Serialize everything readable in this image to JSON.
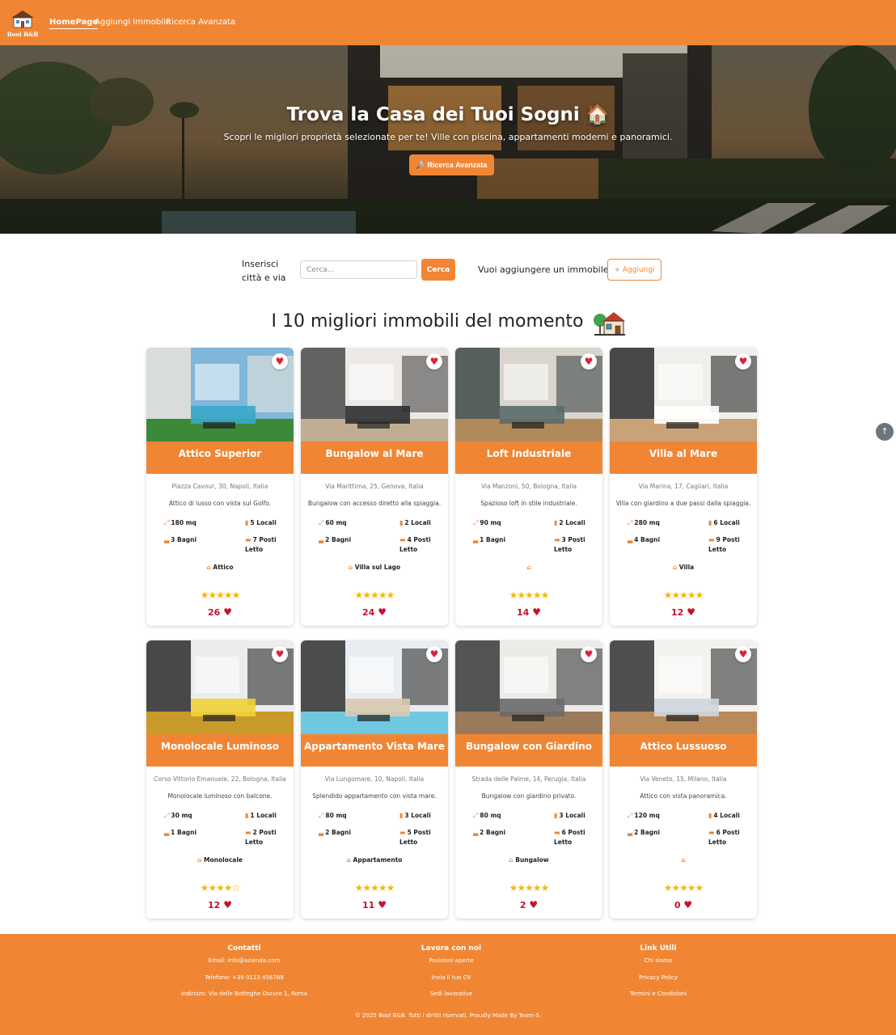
{
  "nav": {
    "logo_text": "Bool B&B",
    "links": [
      "HomePage",
      "Aggiungi Immobile",
      "Ricerca Avanzata"
    ]
  },
  "hero": {
    "title": "Trova la Casa dei Tuoi Sogni 🏠",
    "subtitle": "Scopri le migliori proprietà selezionate per te! Ville con piscina, appartamenti moderni e panoramici.",
    "button": "🔎 Ricerca Avanzata"
  },
  "search": {
    "label": "Inserisci città e via",
    "placeholder": "Cerca...",
    "button": "Cerca",
    "add_label": "Vuoi aggiungere un immobile?",
    "add_button": "+ Aggiungi"
  },
  "section_title": "I 10 migliori immobili del momento",
  "cards": [
    {
      "title": "Attico Superior",
      "address": "Piazza Cavour, 30, Napoli, Italia",
      "description": "Attico di lusso con vista sul Golfo.",
      "mq": "180 mq",
      "locali": "5 Locali",
      "bagni": "3 Bagni",
      "posti": "7 Posti Letto",
      "type": "Attico",
      "rating": 5,
      "likes": "26"
    },
    {
      "title": "Bungalow al Mare",
      "address": "Via Marittima, 25, Genova, Italia",
      "description": "Bungalow con accesso diretto alla spiaggia.",
      "mq": "60 mq",
      "locali": "2 Locali",
      "bagni": "2 Bagni",
      "posti": "4 Posti Letto",
      "type": "Villa sul Lago",
      "rating": 5,
      "likes": "24"
    },
    {
      "title": "Loft Industriale",
      "address": "Via Manzoni, 50, Bologna, Italia",
      "description": "Spazioso loft in stile industriale.",
      "mq": "90 mq",
      "locali": "2 Locali",
      "bagni": "1 Bagni",
      "posti": "3 Posti Letto",
      "type": "",
      "rating": 5,
      "likes": "14"
    },
    {
      "title": "Villa al Mare",
      "address": "Via Marina, 17, Cagliari, Italia",
      "description": "Villa con giardino a due passi dalla spiaggia.",
      "mq": "280 mq",
      "locali": "6 Locali",
      "bagni": "4 Bagni",
      "posti": "9 Posti Letto",
      "type": "Villa",
      "rating": 5,
      "likes": "12"
    },
    {
      "title": "Monolocale Luminoso",
      "address": "Corso Vittorio Emanuele, 22, Bologna, Italia",
      "description": "Monolocale luminoso con balcone.",
      "mq": "30 mq",
      "locali": "1 Locali",
      "bagni": "1 Bagni",
      "posti": "2 Posti Letto",
      "type": "Monolocale",
      "rating": 4,
      "likes": "12"
    },
    {
      "title": "Appartamento Vista Mare",
      "address": "Via Lungomare, 10, Napoli, Italia",
      "description": "Splendido appartamento con vista mare.",
      "mq": "80 mq",
      "locali": "3 Locali",
      "bagni": "2 Bagni",
      "posti": "5 Posti Letto",
      "type": "Appartamento",
      "rating": 5,
      "likes": "11"
    },
    {
      "title": "Bungalow con Giardino",
      "address": "Strada delle Palme, 14, Perugia, Italia",
      "description": "Bungalow con giardino privato.",
      "mq": "80 mq",
      "locali": "3 Locali",
      "bagni": "2 Bagni",
      "posti": "6 Posti Letto",
      "type": "Bungalow",
      "rating": 5,
      "likes": "2"
    },
    {
      "title": "Attico Lussuoso",
      "address": "Via Veneto, 15, Milano, Italia",
      "description": "Attico con vista panoramica.",
      "mq": "120 mq",
      "locali": "4 Locali",
      "bagni": "2 Bagni",
      "posti": "6 Posti Letto",
      "type": "",
      "rating": 5,
      "likes": "0"
    }
  ],
  "footer": {
    "contatti": {
      "title": "Contatti",
      "items": [
        "Email: info@azienda.com",
        "Telefono: +39 0123 456789",
        "Indirizzo: Via delle Botteghe Oscure 1, Roma"
      ]
    },
    "lavora": {
      "title": "Lavora con noi",
      "items": [
        "Posizioni aperte",
        "Invia il tuo CV",
        "Sedi lavorative"
      ]
    },
    "link": {
      "title": "Link Utili",
      "items": [
        "Chi siamo",
        "Privacy Policy",
        "Termini e Condizioni"
      ]
    },
    "copyright": "© 2025 Bool B&B. Tutti i diritti riservati. Proudly Made By Team-5."
  },
  "colors": {
    "accent": "#f08634",
    "star": "#f5b70b",
    "heart": "#c8102e"
  },
  "icons": [
    "house-logo-icon",
    "heart-icon",
    "area-icon",
    "door-icon",
    "bath-icon",
    "bed-icon",
    "home-icon",
    "star-icon",
    "arrow-up-icon"
  ]
}
